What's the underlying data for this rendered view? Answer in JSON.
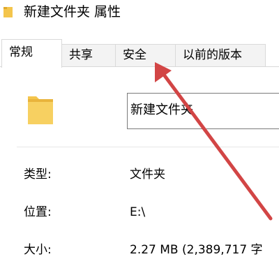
{
  "window": {
    "title": "新建文件夹 属性"
  },
  "tabs": [
    {
      "label": "常规",
      "active": true
    },
    {
      "label": "共享",
      "active": false
    },
    {
      "label": "安全",
      "active": false
    },
    {
      "label": "以前的版本",
      "active": false
    }
  ],
  "general": {
    "folder_name": "新建文件夹",
    "type_label": "类型:",
    "type_value": "文件夹",
    "location_label": "位置:",
    "location_value": "E:\\",
    "size_label": "大小:",
    "size_value": "2.27 MB (2,389,717 字"
  },
  "colors": {
    "arrow": "#d24545",
    "folder": "#f4c54c",
    "tab_bg": "#f3f3f3"
  },
  "icons": {
    "title": "folder-icon",
    "main": "folder-icon",
    "annotation": "red-arrow-pointing-to-security-tab"
  }
}
